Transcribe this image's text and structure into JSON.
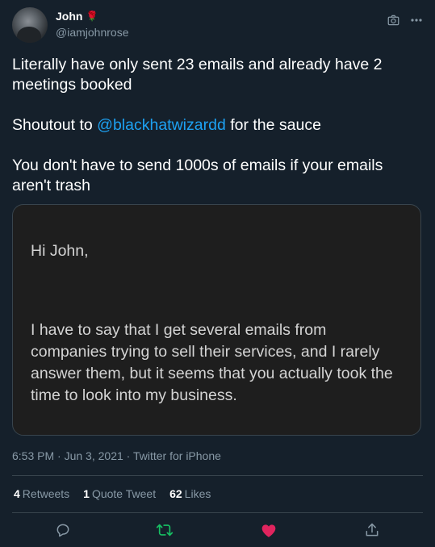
{
  "author": {
    "name": "John",
    "emoji": "🌹",
    "handle": "@iamjohnrose"
  },
  "tweet": {
    "line1": "Literally have only sent 23 emails and already have 2 meetings booked",
    "line2_prefix": "Shoutout to ",
    "line2_mention": "@blackhatwizardd",
    "line2_suffix": " for the sauce",
    "line3": "You don't have to send 1000s of emails if your emails aren't trash"
  },
  "image_card": {
    "greeting": "Hi John,",
    "body": "I have to say that I get several emails from companies trying to sell their services, and I rarely answer them, but it seems that you actually took the time to look into my business."
  },
  "meta": {
    "time": "6:53 PM",
    "sep1": " · ",
    "date": "Jun 3, 2021",
    "sep2": " · ",
    "source": "Twitter for iPhone"
  },
  "stats": {
    "retweets_count": "4",
    "retweets_label": "Retweets",
    "quotes_count": "1",
    "quotes_label": "Quote Tweet",
    "likes_count": "62",
    "likes_label": "Likes"
  },
  "icons": {
    "top": [
      "camera-icon",
      "more-icon"
    ],
    "actions": [
      "reply-icon",
      "retweet-icon",
      "like-icon",
      "share-icon"
    ]
  },
  "colors": {
    "background": "#15202b",
    "mention": "#1da1f2",
    "secondary_text": "#8899a6",
    "retweet_active": "#17bf63",
    "like_active": "#e0245e"
  }
}
